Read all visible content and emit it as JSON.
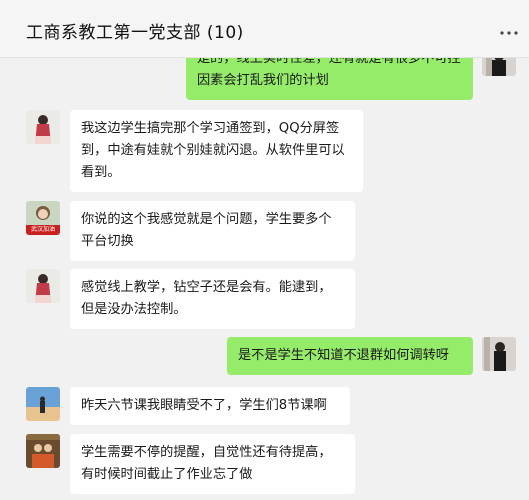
{
  "window": {
    "pin_icon": "pin-icon",
    "minimize_icon": "minimize-icon",
    "maximize_icon": "maximize-icon"
  },
  "header": {
    "title": "工商系教工第一党支部 (10)",
    "more_icon": "more-icon"
  },
  "messages": [
    {
      "direction": "out",
      "avatar": "avatar-self",
      "text": "是的，线上实时性差，还有就是有很多不可控因素会打乱我们的计划"
    },
    {
      "direction": "in",
      "avatar": "avatar-member-a",
      "text": "我这边学生搞完那个学习通签到，QQ分屏签到，中途有娃就个别娃就闪退。从软件里可以看到。"
    },
    {
      "direction": "in",
      "avatar": "avatar-member-b",
      "avatar_text": "武汉加油",
      "text": "你说的这个我感觉就是个问题，学生要多个平台切换"
    },
    {
      "direction": "in",
      "avatar": "avatar-member-a",
      "text": "感觉线上教学，钻空子还是会有。能逮到，但是没办法控制。"
    },
    {
      "direction": "out",
      "avatar": "avatar-self",
      "text": "是不是学生不知道不退群如何调转呀"
    },
    {
      "direction": "in",
      "avatar": "avatar-member-c",
      "text": "昨天六节课我眼睛受不了，学生们8节课啊"
    },
    {
      "direction": "in",
      "avatar": "avatar-member-d",
      "text": "学生需要不停的提醒，自觉性还有待提高，有时候时间截止了作业忘了做"
    }
  ],
  "colors": {
    "outgoing_bubble": "#95ec69",
    "incoming_bubble": "#ffffff",
    "background": "#f1f1f1"
  }
}
